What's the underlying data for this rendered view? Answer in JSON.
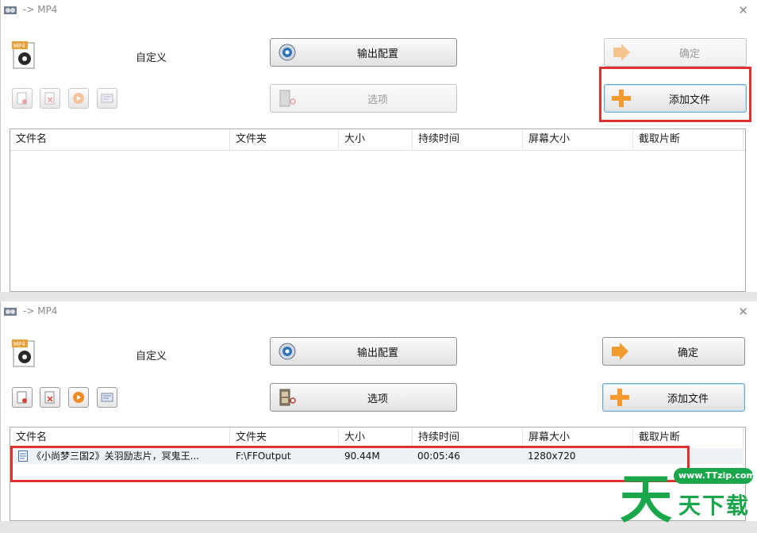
{
  "window": {
    "title": "-> MP4"
  },
  "format_icon_text": "MP4",
  "format_label": "自定义",
  "buttons": {
    "output_config": "输出配置",
    "options": "选项",
    "confirm": "确定",
    "add_file": "添加文件"
  },
  "table": {
    "columns": [
      "文件名",
      "文件夹",
      "大小",
      "持续时间",
      "屏幕大小",
      "截取片断"
    ]
  },
  "file_row": {
    "name": "《小尚梦三国2》关羽励志片，冥鬼王...",
    "folder": "F:\\FFOutput",
    "size": "90.44M",
    "duration": "00:05:46",
    "resolution": "1280x720"
  },
  "watermark": {
    "url": "www.TTzip.com",
    "char_big": "天",
    "text": "天下载"
  },
  "colors": {
    "highlight": "#e03030",
    "accent_green": "#1aa64a",
    "focus_blue": "#6aa9d6"
  }
}
